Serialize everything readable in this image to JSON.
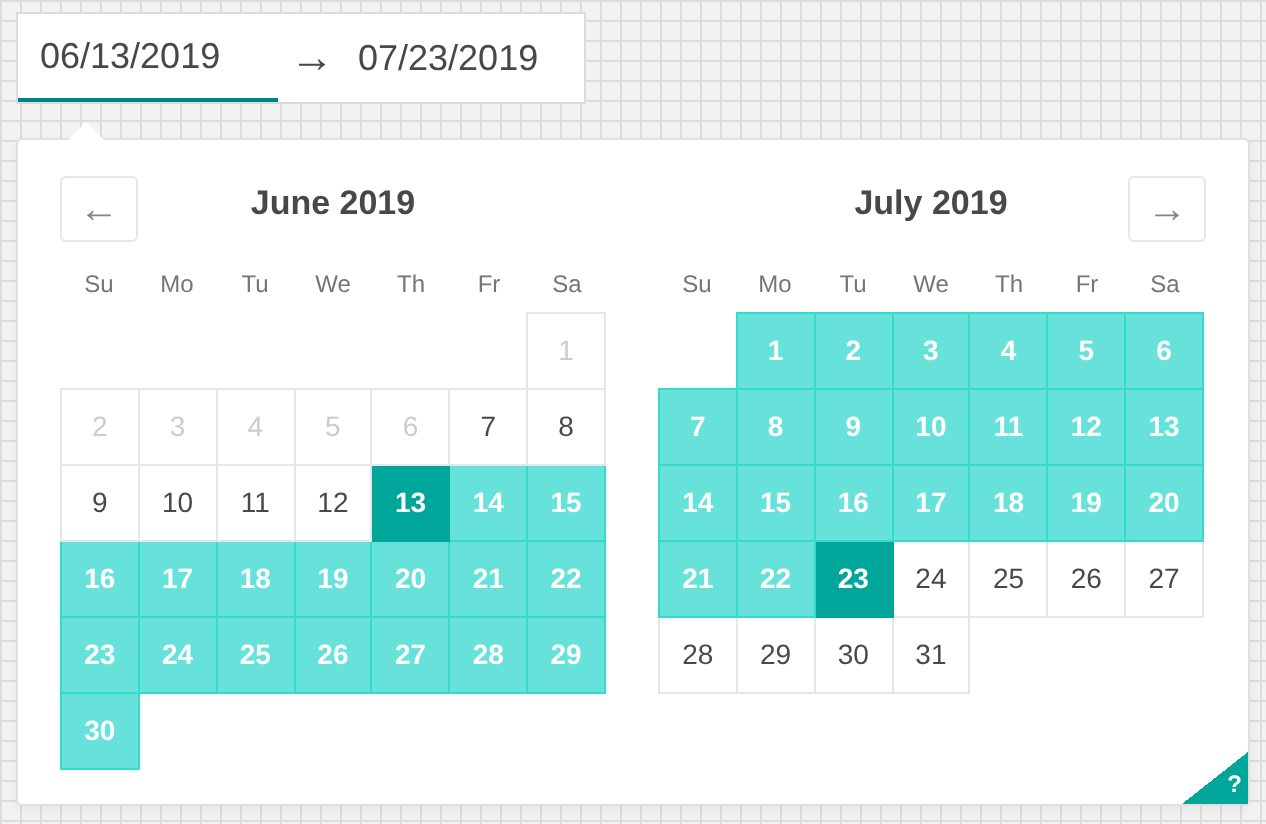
{
  "date_range": {
    "start": "06/13/2019",
    "arrow": "→",
    "end": "07/23/2019",
    "start_focused": true
  },
  "nav": {
    "prev": "←",
    "next": "→"
  },
  "months": [
    {
      "title": "June 2019",
      "weekdays": [
        "Su",
        "Mo",
        "Tu",
        "We",
        "Th",
        "Fr",
        "Sa"
      ],
      "weeks": [
        [
          {
            "d": "1",
            "disabled": true,
            "in_range": false,
            "selected": false
          }
        ],
        [
          {
            "d": "2",
            "disabled": true,
            "in_range": false,
            "selected": false
          },
          {
            "d": "3",
            "disabled": true,
            "in_range": false,
            "selected": false
          },
          {
            "d": "4",
            "disabled": true,
            "in_range": false,
            "selected": false
          },
          {
            "d": "5",
            "disabled": true,
            "in_range": false,
            "selected": false
          },
          {
            "d": "6",
            "disabled": true,
            "in_range": false,
            "selected": false
          },
          {
            "d": "7",
            "disabled": false,
            "in_range": false,
            "selected": false
          },
          {
            "d": "8",
            "disabled": false,
            "in_range": false,
            "selected": false
          }
        ],
        [
          {
            "d": "9",
            "disabled": false,
            "in_range": false,
            "selected": false
          },
          {
            "d": "10",
            "disabled": false,
            "in_range": false,
            "selected": false
          },
          {
            "d": "11",
            "disabled": false,
            "in_range": false,
            "selected": false
          },
          {
            "d": "12",
            "disabled": false,
            "in_range": false,
            "selected": false
          },
          {
            "d": "13",
            "disabled": false,
            "in_range": false,
            "selected": true
          },
          {
            "d": "14",
            "disabled": false,
            "in_range": true,
            "selected": false
          },
          {
            "d": "15",
            "disabled": false,
            "in_range": true,
            "selected": false
          }
        ],
        [
          {
            "d": "16",
            "disabled": false,
            "in_range": true,
            "selected": false
          },
          {
            "d": "17",
            "disabled": false,
            "in_range": true,
            "selected": false
          },
          {
            "d": "18",
            "disabled": false,
            "in_range": true,
            "selected": false
          },
          {
            "d": "19",
            "disabled": false,
            "in_range": true,
            "selected": false
          },
          {
            "d": "20",
            "disabled": false,
            "in_range": true,
            "selected": false
          },
          {
            "d": "21",
            "disabled": false,
            "in_range": true,
            "selected": false
          },
          {
            "d": "22",
            "disabled": false,
            "in_range": true,
            "selected": false
          }
        ],
        [
          {
            "d": "23",
            "disabled": false,
            "in_range": true,
            "selected": false
          },
          {
            "d": "24",
            "disabled": false,
            "in_range": true,
            "selected": false
          },
          {
            "d": "25",
            "disabled": false,
            "in_range": true,
            "selected": false
          },
          {
            "d": "26",
            "disabled": false,
            "in_range": true,
            "selected": false
          },
          {
            "d": "27",
            "disabled": false,
            "in_range": true,
            "selected": false
          },
          {
            "d": "28",
            "disabled": false,
            "in_range": true,
            "selected": false
          },
          {
            "d": "29",
            "disabled": false,
            "in_range": true,
            "selected": false
          }
        ],
        [
          {
            "d": "30",
            "disabled": false,
            "in_range": true,
            "selected": false
          }
        ]
      ]
    },
    {
      "title": "July 2019",
      "weekdays": [
        "Su",
        "Mo",
        "Tu",
        "We",
        "Th",
        "Fr",
        "Sa"
      ],
      "weeks": [
        [
          {
            "d": "1",
            "disabled": false,
            "in_range": true,
            "selected": false
          },
          {
            "d": "2",
            "disabled": false,
            "in_range": true,
            "selected": false
          },
          {
            "d": "3",
            "disabled": false,
            "in_range": true,
            "selected": false
          },
          {
            "d": "4",
            "disabled": false,
            "in_range": true,
            "selected": false
          },
          {
            "d": "5",
            "disabled": false,
            "in_range": true,
            "selected": false
          },
          {
            "d": "6",
            "disabled": false,
            "in_range": true,
            "selected": false
          }
        ],
        [
          {
            "d": "7",
            "disabled": false,
            "in_range": true,
            "selected": false
          },
          {
            "d": "8",
            "disabled": false,
            "in_range": true,
            "selected": false
          },
          {
            "d": "9",
            "disabled": false,
            "in_range": true,
            "selected": false
          },
          {
            "d": "10",
            "disabled": false,
            "in_range": true,
            "selected": false
          },
          {
            "d": "11",
            "disabled": false,
            "in_range": true,
            "selected": false
          },
          {
            "d": "12",
            "disabled": false,
            "in_range": true,
            "selected": false
          },
          {
            "d": "13",
            "disabled": false,
            "in_range": true,
            "selected": false
          }
        ],
        [
          {
            "d": "14",
            "disabled": false,
            "in_range": true,
            "selected": false
          },
          {
            "d": "15",
            "disabled": false,
            "in_range": true,
            "selected": false
          },
          {
            "d": "16",
            "disabled": false,
            "in_range": true,
            "selected": false
          },
          {
            "d": "17",
            "disabled": false,
            "in_range": true,
            "selected": false
          },
          {
            "d": "18",
            "disabled": false,
            "in_range": true,
            "selected": false
          },
          {
            "d": "19",
            "disabled": false,
            "in_range": true,
            "selected": false
          },
          {
            "d": "20",
            "disabled": false,
            "in_range": true,
            "selected": false
          }
        ],
        [
          {
            "d": "21",
            "disabled": false,
            "in_range": true,
            "selected": false
          },
          {
            "d": "22",
            "disabled": false,
            "in_range": true,
            "selected": false
          },
          {
            "d": "23",
            "disabled": false,
            "in_range": false,
            "selected": true
          },
          {
            "d": "24",
            "disabled": false,
            "in_range": false,
            "selected": false
          },
          {
            "d": "25",
            "disabled": false,
            "in_range": false,
            "selected": false
          },
          {
            "d": "26",
            "disabled": false,
            "in_range": false,
            "selected": false
          },
          {
            "d": "27",
            "disabled": false,
            "in_range": false,
            "selected": false
          }
        ],
        [
          {
            "d": "28",
            "disabled": false,
            "in_range": false,
            "selected": false
          },
          {
            "d": "29",
            "disabled": false,
            "in_range": false,
            "selected": false
          },
          {
            "d": "30",
            "disabled": false,
            "in_range": false,
            "selected": false
          },
          {
            "d": "31",
            "disabled": false,
            "in_range": false,
            "selected": false
          }
        ]
      ]
    }
  ],
  "help": "?"
}
